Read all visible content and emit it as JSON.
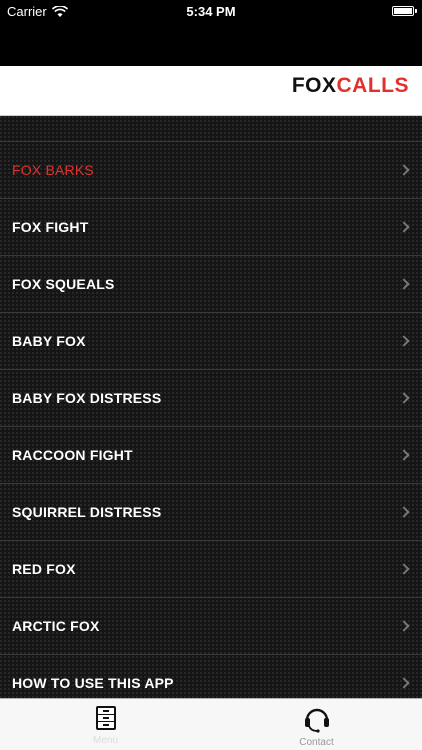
{
  "status_bar": {
    "carrier": "Carrier",
    "time": "5:34 PM",
    "battery_level": 1.0
  },
  "header": {
    "logo_part1": "FOX",
    "logo_part2": "CALLS",
    "logo_colors": {
      "part1": "#111111",
      "part2": "#e0322d"
    }
  },
  "menu": {
    "items": [
      {
        "label": "FOX BARKS",
        "active": true
      },
      {
        "label": "FOX FIGHT",
        "active": false
      },
      {
        "label": "FOX SQUEALS",
        "active": false
      },
      {
        "label": "BABY FOX",
        "active": false
      },
      {
        "label": "BABY FOX DISTRESS",
        "active": false
      },
      {
        "label": "RACCOON FIGHT",
        "active": false
      },
      {
        "label": "SQUIRREL DISTRESS",
        "active": false
      },
      {
        "label": "RED FOX",
        "active": false
      },
      {
        "label": "ARCTIC FOX",
        "active": false
      },
      {
        "label": "HOW TO USE THIS APP",
        "active": false
      }
    ],
    "active_color": "#e0322d"
  },
  "tab_bar": {
    "tabs": [
      {
        "label": "Menu",
        "icon": "filing-cabinet-icon",
        "selected": true
      },
      {
        "label": "Contact",
        "icon": "headset-icon",
        "selected": false
      }
    ]
  }
}
